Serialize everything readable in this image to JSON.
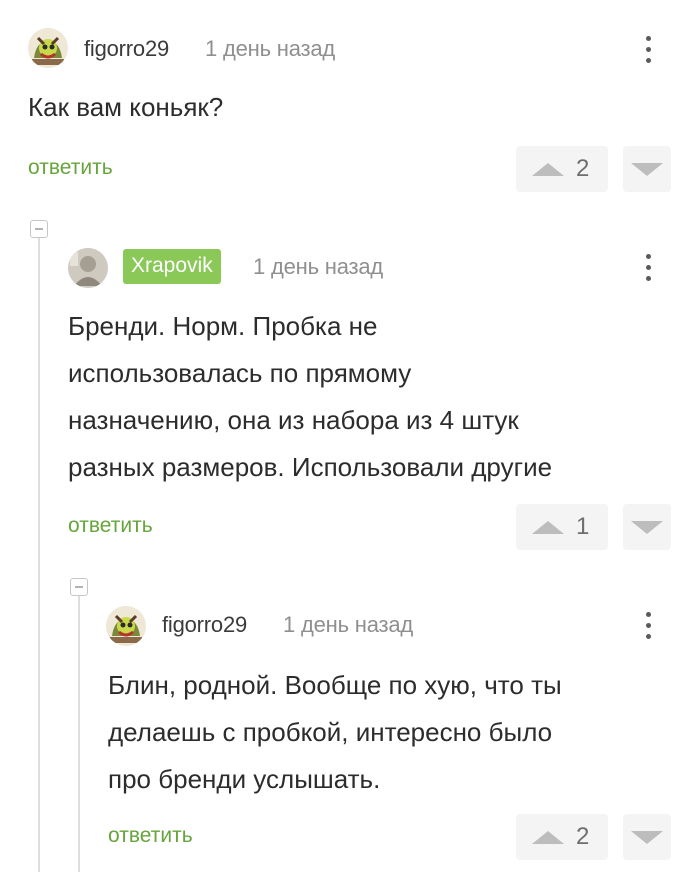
{
  "comments": [
    {
      "author": "figorro29",
      "time": "1 день назад",
      "text": "Как вам коньяк?",
      "reply_label": "ответить",
      "votes": "2"
    },
    {
      "author": "Xrapovik",
      "time": "1 день назад",
      "text_lines": [
        "Бренди. Норм. Пробка не",
        "использовалась по прямому",
        "назначению, она из набора из 4 штук",
        "разных размеров. Использовали другие"
      ],
      "reply_label": "ответить",
      "votes": "1"
    },
    {
      "author": "figorro29",
      "time": "1 день назад",
      "text_lines": [
        "Блин, родной. Вообще по хую, что ты",
        "делаешь с пробкой, интересно было",
        "про бренди услышать."
      ],
      "reply_label": "ответить",
      "votes": "2"
    }
  ],
  "colors": {
    "accent_green": "#66a53b",
    "badge_green": "#8ac858",
    "vote_bg": "#f4f4f4"
  },
  "icons": [
    "avatar",
    "more-vertical-icon",
    "upvote-icon",
    "downvote-icon",
    "collapse-thread-icon"
  ]
}
